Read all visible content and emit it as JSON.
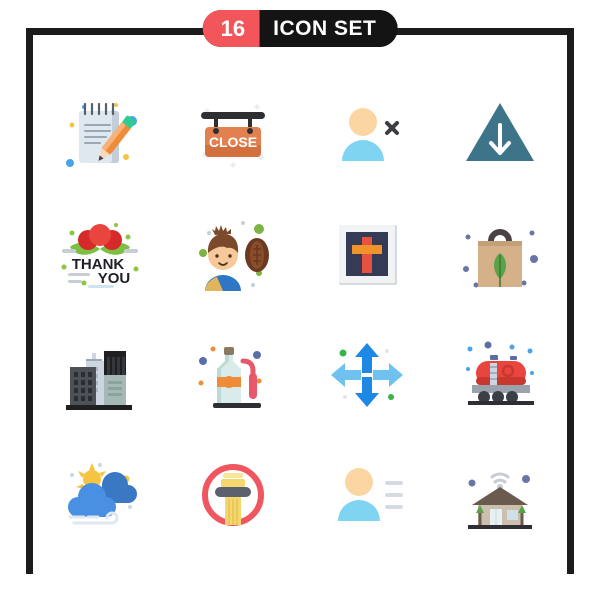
{
  "header": {
    "count": "16",
    "title": "ICON SET",
    "count_bg": "#f2565b",
    "title_bg": "#141414",
    "text_color": "#ffffff"
  },
  "frame": {
    "color": "#1c1c1c"
  },
  "grid": {
    "columns": 4,
    "rows": 4,
    "total": 16
  },
  "icons": [
    {
      "index": 1,
      "name": "notepad-pencil-icon",
      "label": "Notepad with pencil",
      "colors": {
        "paper": "#dfe7ef",
        "paper_shadow": "#c3ced9",
        "lines": "#9aa7b4",
        "pencil_body": "#ef8c3a",
        "pencil_tip": "#f7b27a",
        "eraser": "#2ecc8f",
        "spiral": "#55616e",
        "dot_blue": "#4aa3e8",
        "dot_yellow": "#f5c443"
      }
    },
    {
      "index": 2,
      "name": "close-sign-icon",
      "label": "CLOSE hanging sign",
      "sign_text": "CLOSE",
      "colors": {
        "board": "#e2814f",
        "board_dark": "#d2703f",
        "bar": "#2f2f33",
        "text": "#ffffff",
        "dot": "#eceff2"
      }
    },
    {
      "index": 3,
      "name": "delete-user-icon",
      "label": "Delete user",
      "colors": {
        "head": "#fbd6a3",
        "body": "#7fd4f2",
        "mark": "#3c3c44"
      }
    },
    {
      "index": 4,
      "name": "download-triangle-icon",
      "label": "Download arrow in triangle",
      "colors": {
        "triangle": "#3e7489",
        "arrow": "#ffffff"
      }
    },
    {
      "index": 5,
      "name": "thank-you-card-icon",
      "label": "Thank you card",
      "card_text_top": "THANK",
      "card_text_bottom": "YOU",
      "colors": {
        "berry": "#d62a2a",
        "berry_light": "#e8453f",
        "leaf": "#7bc043",
        "text": "#1f1f27",
        "dash": "#c9ced6",
        "dot_green": "#8cc63f"
      }
    },
    {
      "index": 6,
      "name": "rugby-player-icon",
      "label": "Player with rugby ball",
      "colors": {
        "hair": "#7a4a2a",
        "skin": "#f7c99a",
        "shirt": "#2f77c4",
        "strap": "#e0b55c",
        "ball": "#6b3a20",
        "ball_light": "#8a4d2c",
        "dot_green": "#7cb342"
      }
    },
    {
      "index": 7,
      "name": "framed-cross-icon",
      "label": "Framed cross picture",
      "colors": {
        "frame": "#f1f3f5",
        "frame_edge": "#d6dade",
        "background": "#363b55",
        "cross_v": "#e8503f",
        "cross_h": "#f0932b"
      }
    },
    {
      "index": 8,
      "name": "eco-bag-icon",
      "label": "Eco paper shopping bag",
      "colors": {
        "bag": "#d4b189",
        "bag_dark": "#c3a078",
        "handle": "#4a4244",
        "leaf": "#5aa24a",
        "leaf_dark": "#3f7a36",
        "dot": "#6a74a8"
      }
    },
    {
      "index": 9,
      "name": "city-buildings-icon",
      "label": "City buildings",
      "colors": {
        "tower_black": "#1f1f22",
        "tower_dark": "#4c5258",
        "tower_light": "#cdd6e0",
        "tower_teal": "#a6b8b5",
        "window": "#2b2f33",
        "base": "#1f1f22"
      }
    },
    {
      "index": 10,
      "name": "bottle-pump-icon",
      "label": "Bottle with pump sprayer",
      "colors": {
        "bottle": "#d9ece9",
        "bottle_edge": "#bcd9d6",
        "label": "#ef8c3a",
        "cap": "#8a7a62",
        "pump": "#e8576a",
        "base": "#2f2f33",
        "dot_blue": "#5a6fa8",
        "dot_orange": "#ef8c3a"
      }
    },
    {
      "index": 11,
      "name": "move-arrows-icon",
      "label": "Four directional move arrows",
      "colors": {
        "arrow_dark": "#1e88e5",
        "arrow_light": "#6fc2f0",
        "dot_green": "#36b34a"
      }
    },
    {
      "index": 12,
      "name": "tanker-wagon-icon",
      "label": "Railway tanker wagon",
      "colors": {
        "tank": "#e8453f",
        "tank_dark": "#c8382f",
        "chassis": "#9aa3ab",
        "wheels": "#3a3f45",
        "rail": "#2f2f33",
        "dot_blue": "#4aa3e8"
      }
    },
    {
      "index": 13,
      "name": "windy-cloud-sun-icon",
      "label": "Windy weather with sun",
      "colors": {
        "cloud": "#4a90e2",
        "cloud_dark": "#3b78c4",
        "sun": "#f5c443",
        "wind": "#dfe7ef",
        "dot": "#c9d6e4"
      }
    },
    {
      "index": 14,
      "name": "no-column-icon",
      "label": "Prohibited column",
      "colors": {
        "ring": "#f0565f",
        "column": "#f5d76e",
        "column_light": "#f9e49b",
        "cap": "#5b616e"
      }
    },
    {
      "index": 15,
      "name": "user-details-icon",
      "label": "User profile with details",
      "colors": {
        "head": "#fbd6a3",
        "body": "#7fd4f2",
        "lines": "#d6dbe3"
      }
    },
    {
      "index": 16,
      "name": "smart-home-icon",
      "label": "Smart home with wifi",
      "colors": {
        "roof": "#6b5a4e",
        "wall": "#cdbfae",
        "door": "#e8f0f2",
        "window": "#cfe0e6",
        "tree": "#5aa24a",
        "wifi": "#c6ccd4",
        "ground": "#2f2f33",
        "dot": "#6a74a8"
      }
    }
  ]
}
